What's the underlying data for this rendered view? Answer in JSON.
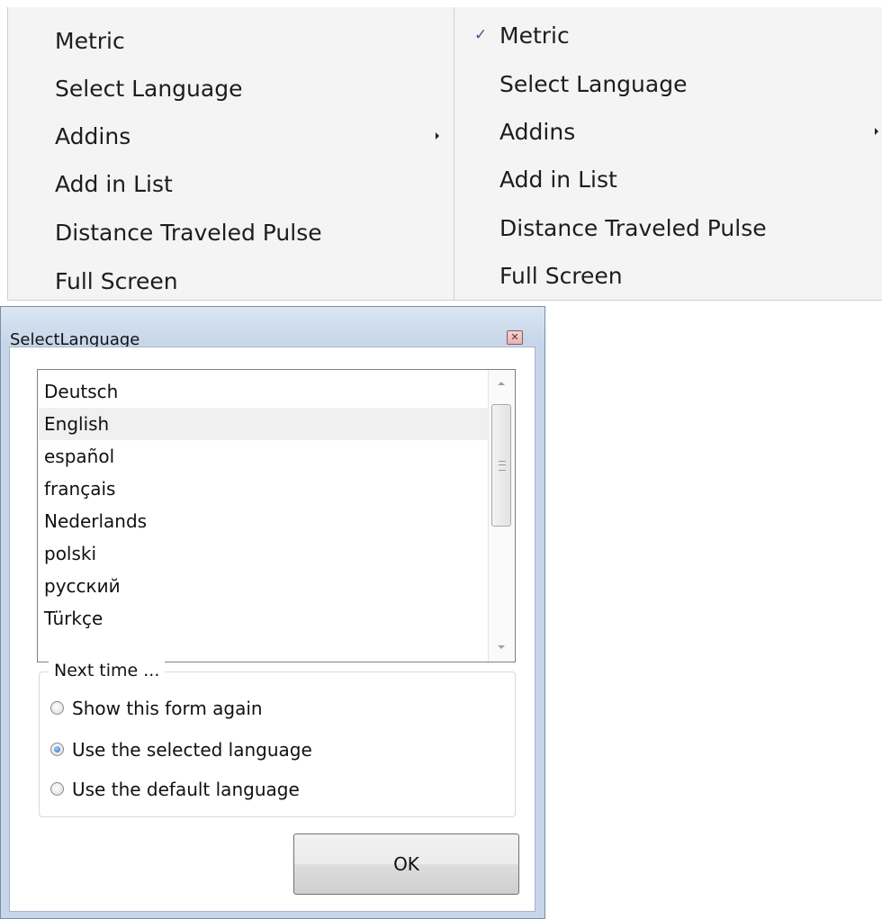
{
  "menu_left": {
    "items": [
      {
        "label": "Metric"
      },
      {
        "label": "Select Language"
      },
      {
        "label": "Addins",
        "submenu": true
      },
      {
        "label": "Add in List"
      },
      {
        "label": "Distance Traveled Pulse"
      },
      {
        "label": "Full Screen"
      }
    ]
  },
  "menu_right": {
    "items": [
      {
        "label": "Metric",
        "checked": true,
        "check_glyph": "✓"
      },
      {
        "label": "Select Language"
      },
      {
        "label": "Addins",
        "submenu": true
      },
      {
        "label": "Add in List"
      },
      {
        "label": "Distance Traveled Pulse"
      },
      {
        "label": "Full Screen"
      }
    ]
  },
  "dialog": {
    "title": "SelectLanguage",
    "close_glyph": "✕",
    "languages": [
      "Deutsch",
      "English",
      "español",
      "français",
      "Nederlands",
      "polski",
      "русский",
      "Türkçe"
    ],
    "selected_language": "English",
    "group_title": "Next time ...",
    "options": [
      {
        "label": "Show this form again",
        "checked": false
      },
      {
        "label": "Use the selected language",
        "checked": true
      },
      {
        "label": "Use the default language",
        "checked": false
      }
    ],
    "ok_label": "OK"
  },
  "colors": {
    "menu_bg": "#f5f4f4",
    "dialog_frame": "#c7d6ea",
    "check_accent": "#3a5a8c",
    "selection_bg": "#f0f0f0"
  }
}
